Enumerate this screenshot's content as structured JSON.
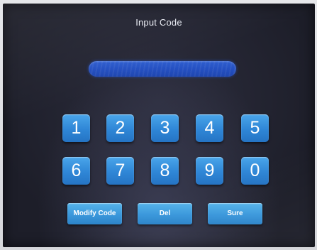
{
  "screen": {
    "title": "Input Code",
    "code_value": ""
  },
  "keypad": {
    "row1": [
      "1",
      "2",
      "3",
      "4",
      "5"
    ],
    "row2": [
      "6",
      "7",
      "8",
      "9",
      "0"
    ]
  },
  "actions": {
    "modify_label": "Modify Code",
    "del_label": "Del",
    "sure_label": "Sure"
  },
  "colors": {
    "key_blue": "#2f86d6",
    "display_blue": "#2550c2",
    "background": "#1d1e29"
  }
}
